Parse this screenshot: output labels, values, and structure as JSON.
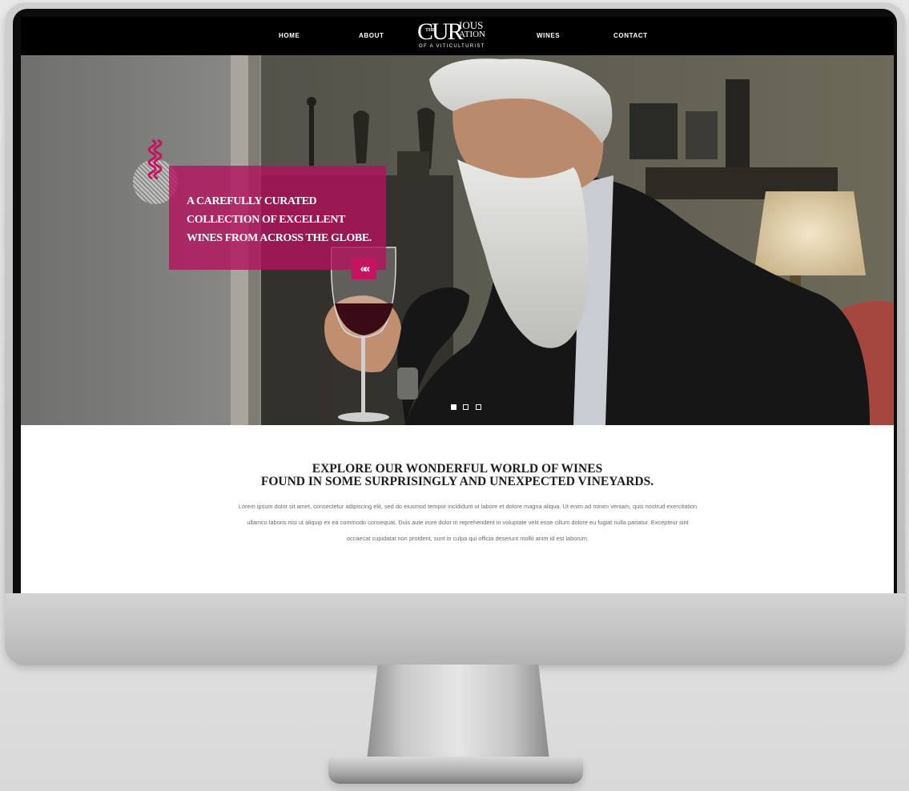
{
  "nav": {
    "home": "HOME",
    "about": "ABOUT",
    "wines": "WINES",
    "contact": "CONTACT"
  },
  "logo": {
    "main": "CUR",
    "the": "THE",
    "top": "IOUS",
    "middle": "ATION",
    "tagline": "OF A VITICULTURIST"
  },
  "hero": {
    "promo_line1": "A CAREFULLY CURATED",
    "promo_line2": "COLLECTION OF EXCELLENT",
    "promo_line3": "WINES FROM ACROSS THE GLOBE.",
    "arrow": "«« ",
    "slides": 3,
    "active_slide": 1
  },
  "content": {
    "headline1": "EXPLORE OUR WONDERFUL WORLD OF WINES",
    "headline2": "FOUND IN SOME SURPRISINGLY AND UNEXPECTED VINEYARDS.",
    "body": "Lorem ipsum dolor sit amet, consectetur adipiscing elit, sed do eiusmod tempor incididunt ut labore et dolore magna aliqua. Ut enim ad minim veniam, quis nostrud exercitation ullamco laboris nisi ut aliquip ex ea commodo consequat. Duis aute irure dolor in reprehenderit in voluptate velit esse cillum dolore eu fugiat nulla pariatur. Excepteur sint occaecat cupidatat non proident, sunt in culpa qui officia deserunt mollit anim id est laborum."
  },
  "colors": {
    "accent": "#b3115e",
    "nav_bg": "#000000",
    "page_bg": "#e6e6e6"
  },
  "icons": [
    "chevron-left-double-icon",
    "squiggle-icon",
    "wine-glass-icon"
  ]
}
